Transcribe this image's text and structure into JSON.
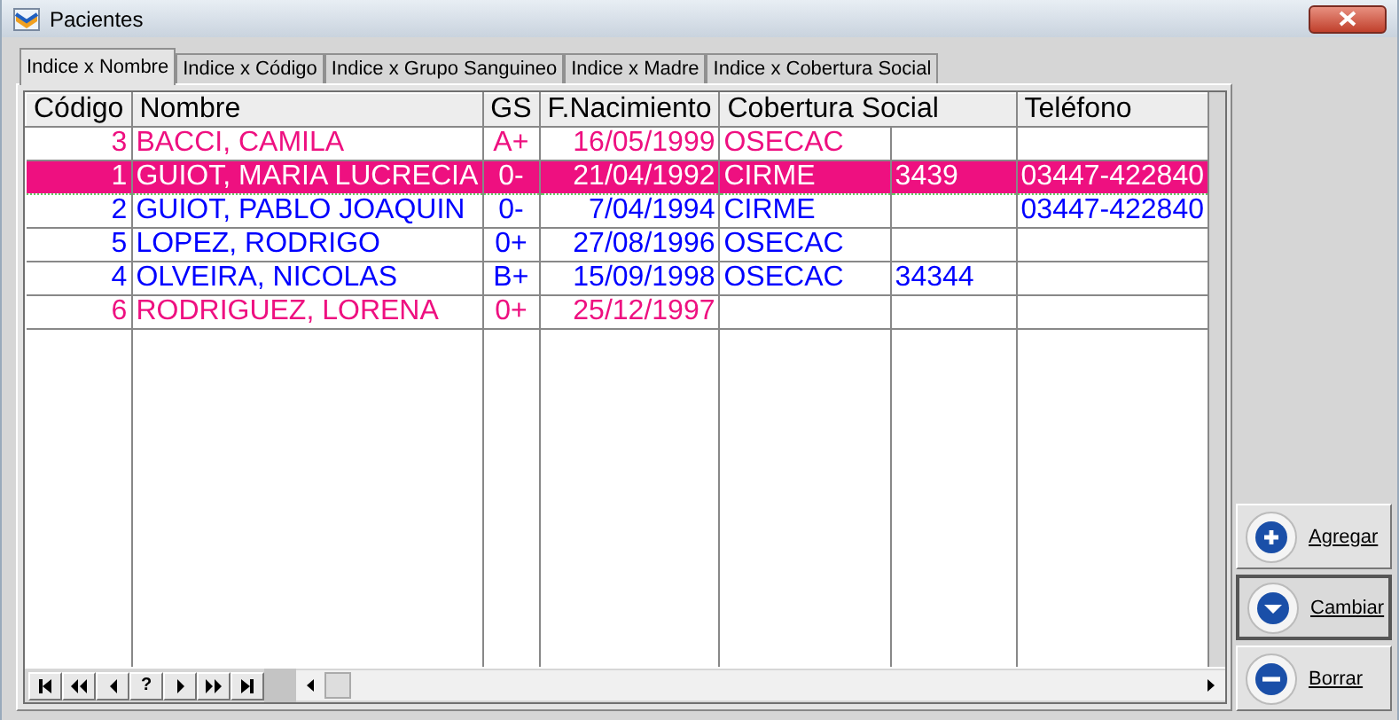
{
  "window": {
    "title": "Pacientes"
  },
  "tabs": [
    {
      "label": "Indice x Nombre",
      "selected": true
    },
    {
      "label": "Indice x Código",
      "selected": false
    },
    {
      "label": "Indice x Grupo Sanguineo",
      "selected": false
    },
    {
      "label": "Indice x Madre",
      "selected": false
    },
    {
      "label": "Indice x Cobertura Social",
      "selected": false
    }
  ],
  "table": {
    "columns": [
      {
        "label": "Código",
        "kind": "normal"
      },
      {
        "label": "Nombre",
        "kind": "normal"
      },
      {
        "label": "GS",
        "kind": "normal"
      },
      {
        "label": "F.Nacimiento",
        "kind": "normal"
      },
      {
        "label": "Cobertura Social",
        "kind": "wide"
      },
      {
        "label": "Teléfono",
        "kind": "normal"
      }
    ],
    "rows": [
      {
        "codigo": "3",
        "nombre": "BACCI, CAMILA",
        "gs": "A+",
        "f_nacimiento": "16/05/1999",
        "cobertura_social": "OSECAC",
        "color": "#ee1080",
        "selected": false
      },
      {
        "codigo": "1",
        "nombre": "GUIOT, MARIA LUCRECIA",
        "gs": "0-",
        "f_nacimiento": "21/04/1992",
        "cobertura_social": "CIRME",
        "column_6": "3439",
        "telefono": "03447-422840",
        "color": "#ee1080",
        "selected": true
      },
      {
        "codigo": "2",
        "nombre": "GUIOT, PABLO JOAQUIN",
        "gs": "0-",
        "f_nacimiento": "7/04/1994",
        "cobertura_social": "CIRME",
        "telefono": "03447-422840",
        "color": "#0000ff",
        "selected": false
      },
      {
        "codigo": "5",
        "nombre": "LOPEZ, RODRIGO",
        "gs": "0+",
        "f_nacimiento": "27/08/1996",
        "cobertura_social": "OSECAC",
        "color": "#0000ff",
        "selected": false
      },
      {
        "codigo": "4",
        "nombre": "OLVEIRA, NICOLAS",
        "gs": "B+",
        "f_nacimiento": "15/09/1998",
        "cobertura_social": "OSECAC",
        "column_6": "34344",
        "color": "#0000ff",
        "selected": false
      },
      {
        "codigo": "6",
        "nombre": "RODRIGUEZ, LORENA",
        "gs": "0+",
        "f_nacimiento": "25/12/1997",
        "color": "#ee1080",
        "selected": false
      }
    ]
  },
  "navigator": [
    {
      "kind": "first"
    },
    {
      "kind": "prior_page"
    },
    {
      "kind": "prior"
    },
    {
      "kind": "text",
      "label": "?"
    },
    {
      "kind": "next"
    },
    {
      "kind": "next_page"
    },
    {
      "kind": "last"
    }
  ],
  "buttons": [
    {
      "label": "Agregar",
      "kind": "plus",
      "selected": false
    },
    {
      "label": "Cambiar",
      "kind": "down",
      "selected": true
    },
    {
      "label": "Borrar",
      "kind": "minus",
      "selected": false
    }
  ]
}
